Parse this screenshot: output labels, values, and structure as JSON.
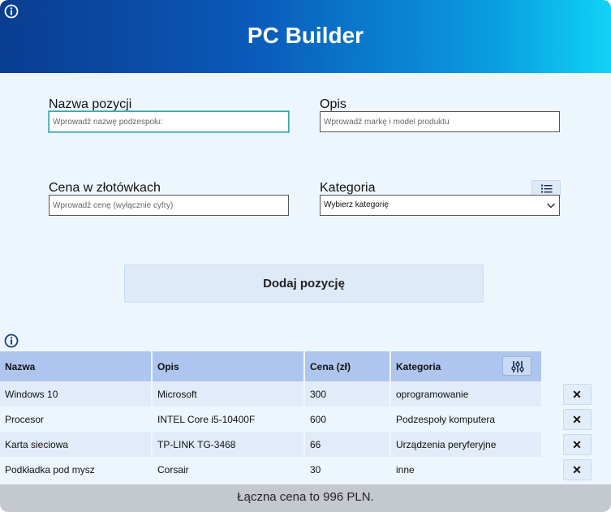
{
  "header": {
    "title": "PC Builder"
  },
  "form": {
    "name": {
      "label": "Nazwa pozycji",
      "placeholder": "Wprowadź nazwę podzespołu:"
    },
    "description": {
      "label": "Opis",
      "placeholder": "Wprowadź markę i model produktu"
    },
    "price": {
      "label": "Cena w złotówkach",
      "placeholder": "Wprowadź cenę (wyłącznie cyfry)"
    },
    "category": {
      "label": "Kategoria",
      "selected": "Wybierz kategorię"
    },
    "add_label": "Dodaj pozycję"
  },
  "table": {
    "headers": [
      "Nazwa",
      "Opis",
      "Cena (zł)",
      "Kategoria"
    ],
    "delete_label": "✕",
    "rows": [
      {
        "name": "Windows 10",
        "description": "Microsoft",
        "price": "300",
        "category": "oprogramowanie"
      },
      {
        "name": "Procesor",
        "description": "INTEL Core i5-10400F",
        "price": "600",
        "category": "Podzespoły komputera"
      },
      {
        "name": "Karta sieciowa",
        "description": "TP-LINK TG-3468",
        "price": "66",
        "category": "Urządzenia peryferyjne"
      },
      {
        "name": "Podkładka pod mysz",
        "description": "Corsair",
        "price": "30",
        "category": "inne"
      }
    ]
  },
  "footer": {
    "total_text": "Łączna cena to 996 PLN."
  },
  "colors": {
    "header_start": "#0a3d91",
    "header_end": "#10d2f5",
    "table_header": "#aec6ef",
    "footer": "#c4c9d0"
  }
}
